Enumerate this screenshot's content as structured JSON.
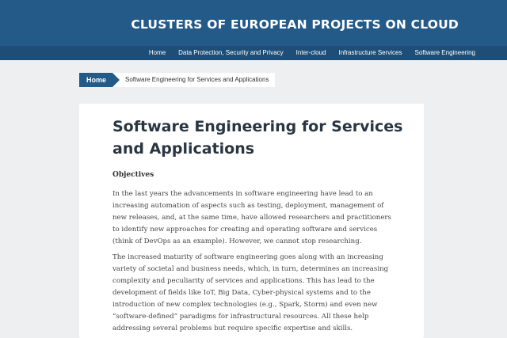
{
  "header": {
    "site_title": "CLUSTERS OF EUROPEAN PROJECTS ON CLOUD"
  },
  "nav": {
    "items": [
      "Home",
      "Data Protection, Security and Privacy",
      "Inter-cloud",
      "Infrastructure Services",
      "Software Engineering"
    ]
  },
  "breadcrumb": {
    "home": "Home",
    "current": "Software Engineering for Services and Applications"
  },
  "article": {
    "title": "Software Engineering for Services and Applications",
    "section": "Objectives",
    "paragraphs": [
      "In the last years the advancements in software engineering have lead to an increasing automation of aspects such as testing, deployment, management of new releases, and, at the same time, have allowed researchers and practitioners to identify new approaches for creating and operating software and services (think of DevOps as an example). However, we cannot stop researching.",
      "The increased maturity of software engineering goes along with an increasing variety of societal and business needs, which, in turn, determines an increasing complexity and peculiarity of services and applications. This has lead to the development of fields like IoT, Big Data, Cyber-physical systems and to the introduction of new complex technologies (e.g., Spark, Storm) and even new “software-defined” paradigms for infrastructural resources. All these help addressing several problems but require specific expertise and skills."
    ]
  },
  "colors": {
    "header_bg": "#245a88",
    "navbar_bg": "#1e4e77",
    "page_bg": "#eeeff1",
    "title_text": "#2a3542"
  }
}
